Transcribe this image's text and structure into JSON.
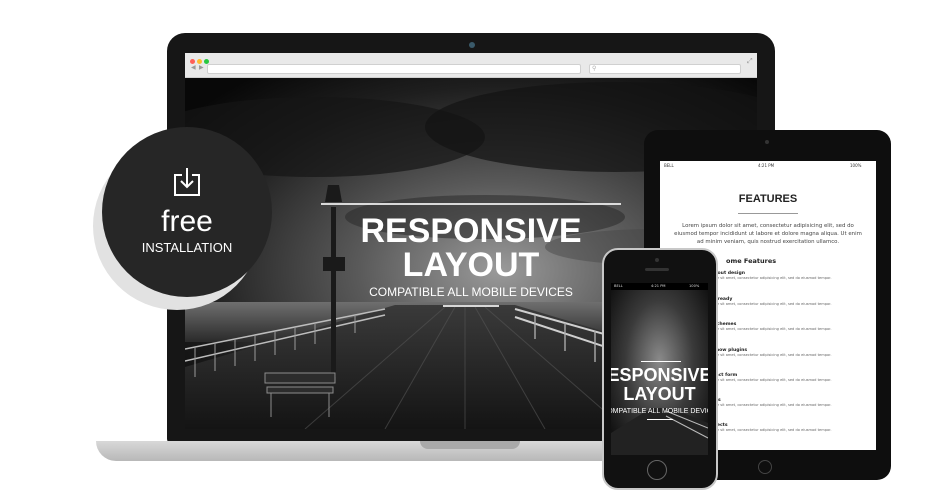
{
  "badge": {
    "icon": "download-icon",
    "label_main": "free",
    "label_sub": "INSTALLATION"
  },
  "laptop_hero": {
    "title_line1": "RESPONSIVE",
    "title_line2": "LAYOUT",
    "subtitle": "COMPATIBLE ALL MOBILE DEVICES"
  },
  "phone_hero": {
    "title_line1": "ESPONSIVE",
    "title_line2": "LAYOUT",
    "subtitle": "OMPATIBLE ALL MOBILE DEVIC",
    "status_carrier": "BELL",
    "status_time": "4:21 PM",
    "status_battery": "100%"
  },
  "tablet": {
    "status_carrier": "BELL",
    "status_time": "4:21 PM",
    "status_battery": "100%",
    "title": "FEATURES",
    "paragraph": "Lorem ipsum dolor sit amet, consectetur adipisicing elit, sed do eiusmod tempor incididunt ut labore et dolore magna aliqua. Ut enim ad minim veniam, quis nostrud exercitation ullamco.",
    "features_heading": "ome Features",
    "features": [
      {
        "name": "layout design",
        "desc": "dolor sit amet, consectetur adipisicing elit, sed do eiusmod tempor."
      },
      {
        "name": "ay ready",
        "desc": "dolor sit amet, consectetur adipisicing elit, sed do eiusmod tempor."
      },
      {
        "name": "r schemes",
        "desc": "dolor sit amet, consectetur adipisicing elit, sed do eiusmod tempor."
      },
      {
        "name": "eshow plugins",
        "desc": "dolor sit amet, consectetur adipisicing elit, sed do eiusmod tempor."
      },
      {
        "name": "ntact form",
        "desc": "dolor sit amet, consectetur adipisicing elit, sed do eiusmod tempor."
      },
      {
        "name": "ects",
        "desc": "dolor sit amet, consectetur adipisicing elit, sed do eiusmod tempor."
      },
      {
        "name": "effects",
        "desc": "dolor sit amet, consectetur adipisicing elit, sed do eiusmod tempor."
      }
    ]
  },
  "colors": {
    "badge_bg": "#262626",
    "device_dark": "#111111",
    "laptop_base": "#c8c8c8",
    "window_red": "#ff5f57",
    "window_yellow": "#febc2e",
    "window_green": "#28c840"
  }
}
